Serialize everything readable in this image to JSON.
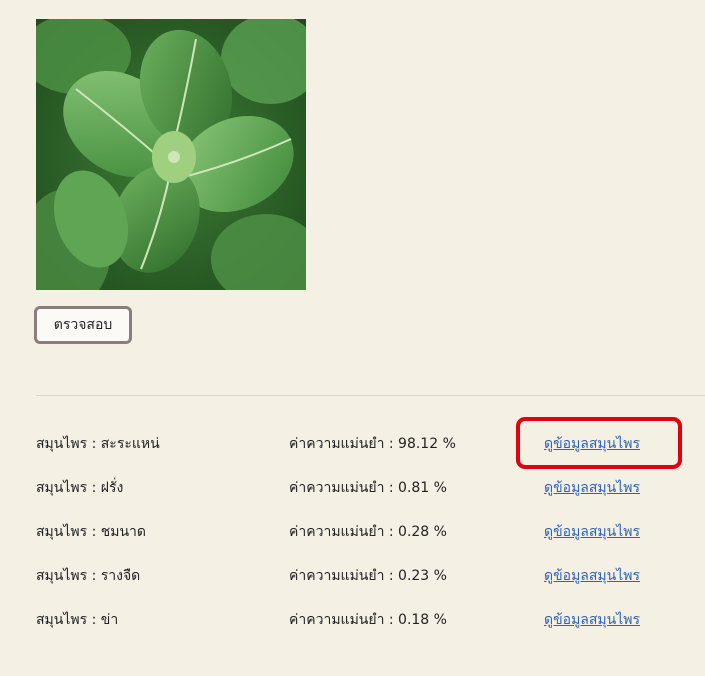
{
  "image": {
    "alt": "mint leaves",
    "icon": "herb-photo"
  },
  "check_button": {
    "label": "ตรวจสอบ"
  },
  "results": [
    {
      "herb": "สมุนไพร : สะระแหน่",
      "accuracy": "ค่าความแม่นยำ : 98.12 %",
      "link": "ดูข้อมูลสมุนไพร",
      "highlighted": true
    },
    {
      "herb": "สมุนไพร : ฝรั่ง",
      "accuracy": "ค่าความแม่นยำ : 0.81 %",
      "link": "ดูข้อมูลสมุนไพร",
      "highlighted": false
    },
    {
      "herb": "สมุนไพร : ชมนาด",
      "accuracy": "ค่าความแม่นยำ : 0.28 %",
      "link": "ดูข้อมูลสมุนไพร",
      "highlighted": false
    },
    {
      "herb": "สมุนไพร : รางจืด",
      "accuracy": "ค่าความแม่นยำ : 0.23 %",
      "link": "ดูข้อมูลสมุนไพร",
      "highlighted": false
    },
    {
      "herb": "สมุนไพร : ข่า",
      "accuracy": "ค่าความแม่นยำ : 0.18 %",
      "link": "ดูข้อมูลสมุนไพร",
      "highlighted": false
    }
  ],
  "colors": {
    "background": "#f4f0e4",
    "link": "#2f63b5",
    "highlight": "#e3000f",
    "button_border": "#8a7d7b"
  }
}
